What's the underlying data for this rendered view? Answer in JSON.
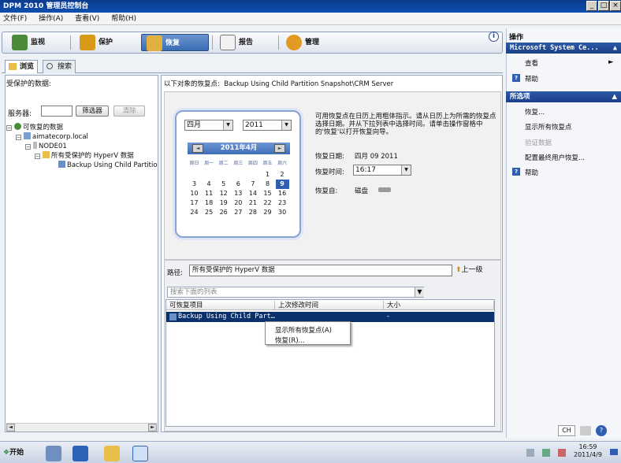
{
  "window": {
    "title": "DPM 2010 管理员控制台"
  },
  "menu": [
    "文件(F)",
    "操作(A)",
    "查看(V)",
    "帮助(H)"
  ],
  "nav_tabs": [
    "监视",
    "保护",
    "恢复",
    "报告",
    "管理"
  ],
  "sub_tabs": [
    "浏览",
    "搜索"
  ],
  "left": {
    "header": "受保护的数据:",
    "server_label": "服务器:",
    "filter_button": "筛选器",
    "clear_button": "清除",
    "tree": [
      "可恢复的数据",
      "aimatecorp.local",
      "NODE01",
      "所有受保护的 HyperV 数据",
      "Backup Using Child Partitio"
    ]
  },
  "main": {
    "header_label": "以下对象的恢复点:",
    "header_value": "Backup Using Child Partition Snapshot\\CRM Server",
    "month": "四月",
    "year": "2011",
    "calendar_title": "2011年4月",
    "weekdays": [
      "周日",
      "周一",
      "周二",
      "周三",
      "周四",
      "周五",
      "周六"
    ],
    "days": [
      "1",
      "2",
      "3",
      "4",
      "5",
      "6",
      "7",
      "8",
      "9",
      "10",
      "11",
      "12",
      "13",
      "14",
      "15",
      "16",
      "17",
      "18",
      "19",
      "20",
      "21",
      "22",
      "23",
      "24",
      "25",
      "26",
      "27",
      "28",
      "29",
      "30"
    ],
    "selected_day": "9",
    "instructions": "可用恢复点在日历上用粗体指示。请从日历上为所需的恢复点选择日期。并从下拉列表中选择时间。请单击操作窗格中的'恢复'以打开恢复向导。",
    "recovery_date_label": "恢复日期:",
    "recovery_date_value": "四月 09 2011",
    "recovery_time_label": "恢复时间:",
    "recovery_time_value": "16:17",
    "recover_from_label": "恢复自:",
    "recover_from_value": "磁盘",
    "path_label": "路径:",
    "path_value": "所有受保护的 HyperV 数据",
    "up_button": "上一级",
    "search_placeholder": "搜索下面的列表",
    "columns": [
      "可恢复项目",
      "上次修改时间",
      "大小"
    ],
    "row": {
      "name": "Backup Using Child Part…",
      "modified": "-"
    },
    "context_menu": [
      "显示所有恢复点(A)",
      "恢复(R)..."
    ]
  },
  "actions": {
    "title": "操作",
    "group": "Microsoft System Ce...",
    "items": [
      "查看",
      "帮助"
    ],
    "options_title": "所选项",
    "options": [
      "恢复...",
      "显示所有恢复点",
      "验证数据",
      "配置最终用户恢复...",
      "帮助"
    ]
  },
  "statusbar": {
    "lang": "CH"
  },
  "taskbar": {
    "start": "开始",
    "time": "16:59",
    "date": "2011/4/9"
  }
}
